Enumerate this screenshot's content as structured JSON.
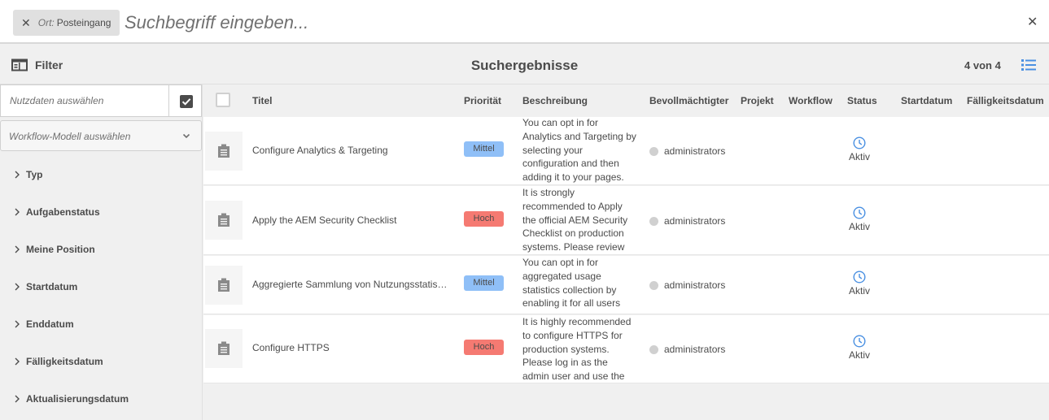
{
  "search": {
    "tag_key": "Ort:",
    "tag_value": "Posteingang",
    "placeholder": "Suchbegriff eingeben..."
  },
  "toolbar": {
    "filter_label": "Filter",
    "title": "Suchergebnisse",
    "count": "4 von 4"
  },
  "rail": {
    "payload_placeholder": "Nutzdaten auswählen",
    "workflow_model_placeholder": "Workflow-Modell auswählen",
    "facets": [
      "Typ",
      "Aufgabenstatus",
      "Meine Position",
      "Startdatum",
      "Enddatum",
      "Fälligkeitsdatum",
      "Aktualisierungsdatum"
    ]
  },
  "table": {
    "columns": [
      "Titel",
      "Priorität",
      "Beschreibung",
      "Bevollmächtigter",
      "Projekt",
      "Workflow",
      "Status",
      "Startdatum",
      "Fälligkeitsdatum"
    ],
    "rows": [
      {
        "title": "Configure Analytics & Targeting",
        "priority": "Mittel",
        "description": "You can opt in for Analytics and Targeting by selecting your configuration and then adding it to your pages.",
        "assignee": "administrators",
        "status": "Aktiv"
      },
      {
        "title": "Apply the AEM Security Checklist",
        "priority": "Hoch",
        "description": "It is strongly recommended to Apply the official AEM Security Checklist on production systems. Please review",
        "assignee": "administrators",
        "status": "Aktiv"
      },
      {
        "title": "Aggregierte Sammlung von Nutzungsstatistiken",
        "priority": "Mittel",
        "description": "You can opt in for aggregated usage statistics collection by enabling it for all users",
        "assignee": "administrators",
        "status": "Aktiv"
      },
      {
        "title": "Configure HTTPS",
        "priority": "Hoch",
        "description": "It is highly recommended to configure HTTPS for production systems. Please log in as the admin user and use the",
        "assignee": "administrators",
        "status": "Aktiv"
      }
    ]
  },
  "colors": {
    "priority_mittel": "#8fbff7",
    "priority_hoch": "#f57a72",
    "status_icon": "#4a90e2"
  }
}
